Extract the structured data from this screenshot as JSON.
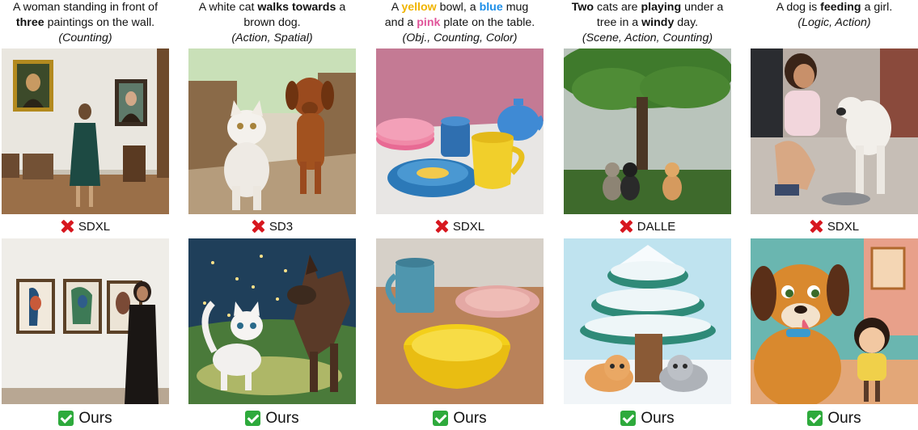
{
  "columns": [
    {
      "caption": {
        "pre": "A woman standing in front of",
        "bold": "three",
        "post": "paintings on the wall.",
        "tags": "(Counting)"
      },
      "baseline_label": "SDXL",
      "ours_label": "Ours"
    },
    {
      "caption": {
        "pre": "A white cat",
        "bold": "walks towards",
        "post": "a brown dog.",
        "tags": "(Action, Spatial)"
      },
      "baseline_label": "SD3",
      "ours_label": "Ours"
    },
    {
      "caption": {
        "w1": "A",
        "yellow": "yellow",
        "w2": "bowl, a",
        "blue": "blue",
        "w3": "mug",
        "w4": "and a",
        "pink": "pink",
        "w5": "plate on the table.",
        "tags": "(Obj., Counting, Color)"
      },
      "baseline_label": "SDXL",
      "ours_label": "Ours"
    },
    {
      "caption": {
        "bold1": "Two",
        "mid1": "cats are",
        "bold2": "playing",
        "mid2": "under a tree in a",
        "bold3": "windy",
        "post": "day.",
        "tags": "(Scene, Action, Counting)"
      },
      "baseline_label": "DALLE",
      "ours_label": "Ours"
    },
    {
      "caption": {
        "pre": "A dog is",
        "bold": "feeding",
        "post": "a girl.",
        "tags": "(Logic, Action)"
      },
      "baseline_label": "SDXL",
      "ours_label": "Ours"
    }
  ],
  "colors": {
    "fail": "#d7171f",
    "pass": "#2eaa3c",
    "yellow": "#f0b400",
    "blue": "#1e8fe8",
    "pink": "#e0559a"
  },
  "icons": {
    "fail": "cross-mark-icon",
    "pass": "check-mark-icon"
  }
}
